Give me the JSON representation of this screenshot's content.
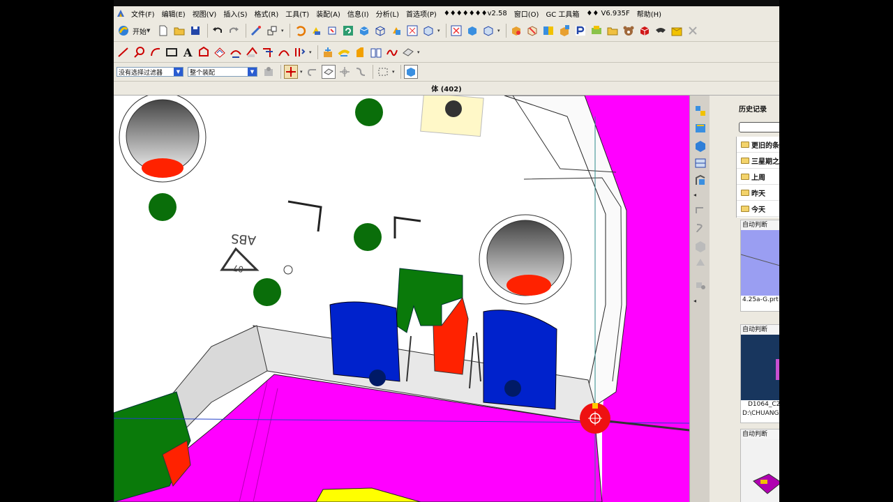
{
  "menu": {
    "items": [
      "文件(F)",
      "编辑(E)",
      "视图(V)",
      "插入(S)",
      "格式(R)",
      "工具(T)",
      "装配(A)",
      "信息(I)",
      "分析(L)",
      "首选项(P)",
      "♦♦♦♦♦♦♦v2.58",
      "窗口(O)",
      "GC 工具箱",
      "♦♦ V6.935F",
      "帮助(H)"
    ]
  },
  "toolbar": {
    "start_label": "开始",
    "filter_value": "没有选择过滤器",
    "scope_value": "整个装配"
  },
  "status": {
    "selection_text": "体 (402)"
  },
  "model": {
    "part_marking": "ABS",
    "recycle_code": "07"
  },
  "history": {
    "title": "历史记录",
    "groups": [
      "更旧的条目",
      "三星期之前",
      "上周",
      "昨天",
      "今天"
    ],
    "entries": [
      {
        "tag": "自动判断",
        "name": "4.25a-G.prt",
        "path": ""
      },
      {
        "tag": "自动判断",
        "name": "D1064_C2",
        "path": "D:\\CHUANG"
      },
      {
        "tag": "自动判断",
        "name": "",
        "path": ""
      }
    ]
  },
  "colors": {
    "magenta": "#ff00ff",
    "cavity": "#ff2200",
    "boss": "#006600",
    "block": "#0022cc"
  }
}
